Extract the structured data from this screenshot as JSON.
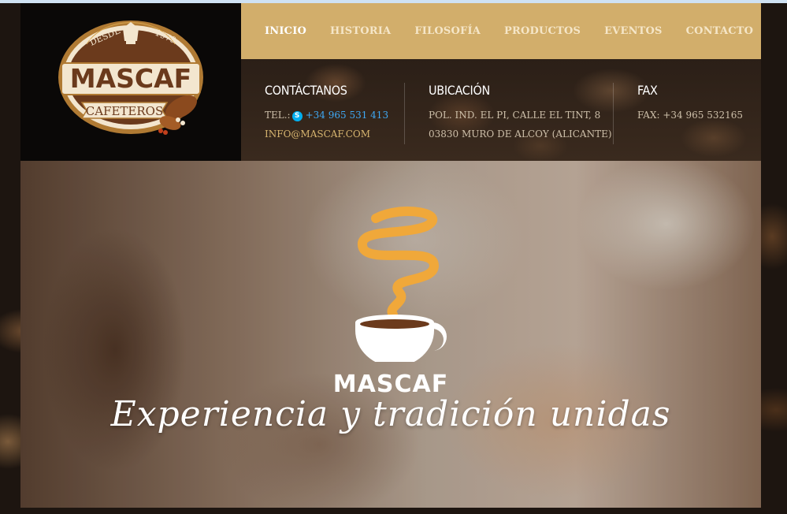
{
  "logo": {
    "since": "DESDE",
    "year": "1979",
    "brand": "MASCAF",
    "ribbon": "CAFETEROS"
  },
  "nav": {
    "items": [
      {
        "label": "INICIO",
        "active": true
      },
      {
        "label": "HISTORIA"
      },
      {
        "label": "FILOSOFÍA"
      },
      {
        "label": "PRODUCTOS"
      },
      {
        "label": "EVENTOS"
      },
      {
        "label": "CONTACTO"
      }
    ]
  },
  "contact": {
    "heading": "CONTÁCTANOS",
    "tel_label": "TEL.:",
    "tel_value": "+34 965 531 413",
    "email": "INFO@MASCAF.COM"
  },
  "location": {
    "heading": "UBICACIÓN",
    "line1": "POL. IND. EL PI, CALLE EL TINT, 8",
    "line2": "03830 MURO DE ALCOY (ALICANTE)"
  },
  "fax": {
    "heading": "FAX",
    "line": "FAX: +34 965 532165"
  },
  "hero": {
    "brand": "MASCAF",
    "tagline": "Experiencia y tradición unidas"
  },
  "colors": {
    "nav_bg": "#d2ae6b",
    "accent_gold": "#d7b56f",
    "link_blue": "#3fa9f5",
    "logo_bg": "#0a0807"
  }
}
